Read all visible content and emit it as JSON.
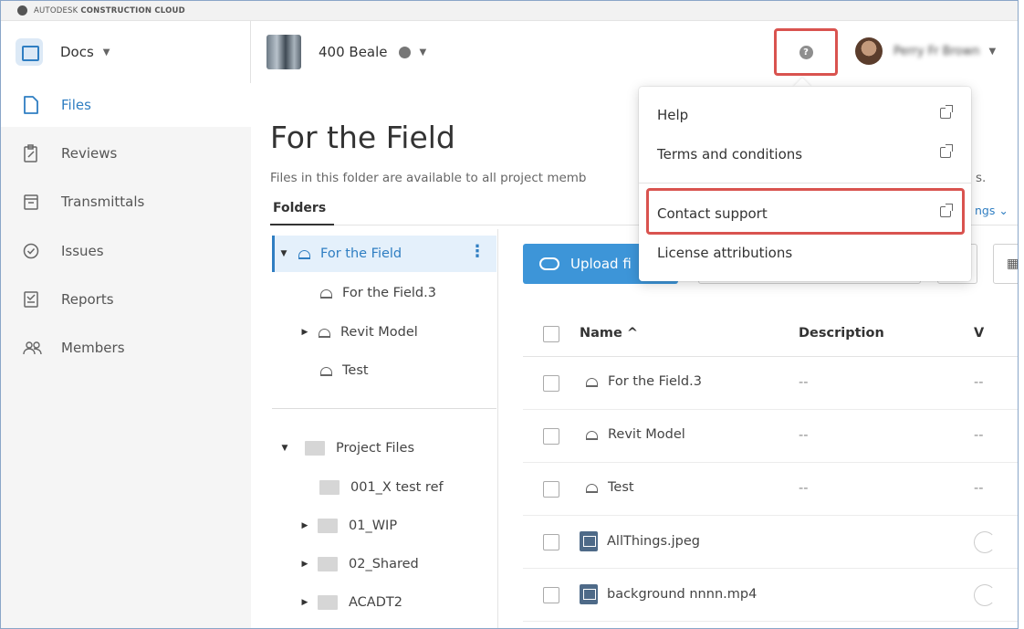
{
  "brand": {
    "prefix": "AUTODESK",
    "suffix": "CONSTRUCTION CLOUD"
  },
  "header": {
    "module": "Docs",
    "project": "400 Beale",
    "user_name": "Perry Fr Brown"
  },
  "sidebar": {
    "items": [
      {
        "label": "Files",
        "icon": "file-icon",
        "active": true
      },
      {
        "label": "Reviews",
        "icon": "reviews-icon"
      },
      {
        "label": "Transmittals",
        "icon": "transmittals-icon"
      },
      {
        "label": "Issues",
        "icon": "issues-icon"
      },
      {
        "label": "Reports",
        "icon": "reports-icon"
      },
      {
        "label": "Members",
        "icon": "members-icon"
      }
    ]
  },
  "main": {
    "title": "For the Field",
    "description": "Files in this folder are available to all project memb",
    "description_tail": "s.",
    "tab": "Folders",
    "settings_fragment": "ngs"
  },
  "tree": {
    "group1": [
      {
        "label": "For the Field",
        "selected": true
      },
      {
        "label": "For the Field.3"
      },
      {
        "label": "Revit Model"
      },
      {
        "label": "Test"
      }
    ],
    "group2": [
      {
        "label": "Project Files"
      },
      {
        "label": "001_X test ref"
      },
      {
        "label": "01_WIP"
      },
      {
        "label": "02_Shared"
      },
      {
        "label": "ACADT2"
      }
    ]
  },
  "toolbar": {
    "upload_label": "Upload fi"
  },
  "table": {
    "headers": {
      "name": "Name ^",
      "description": "Description",
      "v": "V"
    },
    "rows": [
      {
        "name": "For the Field.3",
        "description": "--",
        "v": "--"
      },
      {
        "name": "Revit Model",
        "description": "--",
        "v": "--"
      },
      {
        "name": "Test",
        "description": "--",
        "v": "--"
      },
      {
        "name": "AllThings.jpeg",
        "description": "",
        "v": ""
      },
      {
        "name": "background nnnn.mp4",
        "description": "",
        "v": ""
      }
    ]
  },
  "help_menu": {
    "items": [
      {
        "label": "Help"
      },
      {
        "label": "Terms and conditions"
      },
      {
        "label": "Contact support"
      },
      {
        "label": "License attributions"
      }
    ]
  },
  "colors": {
    "accent": "#2f7ec2",
    "upload": "#3d95d8",
    "highlight": "#d9534f"
  }
}
